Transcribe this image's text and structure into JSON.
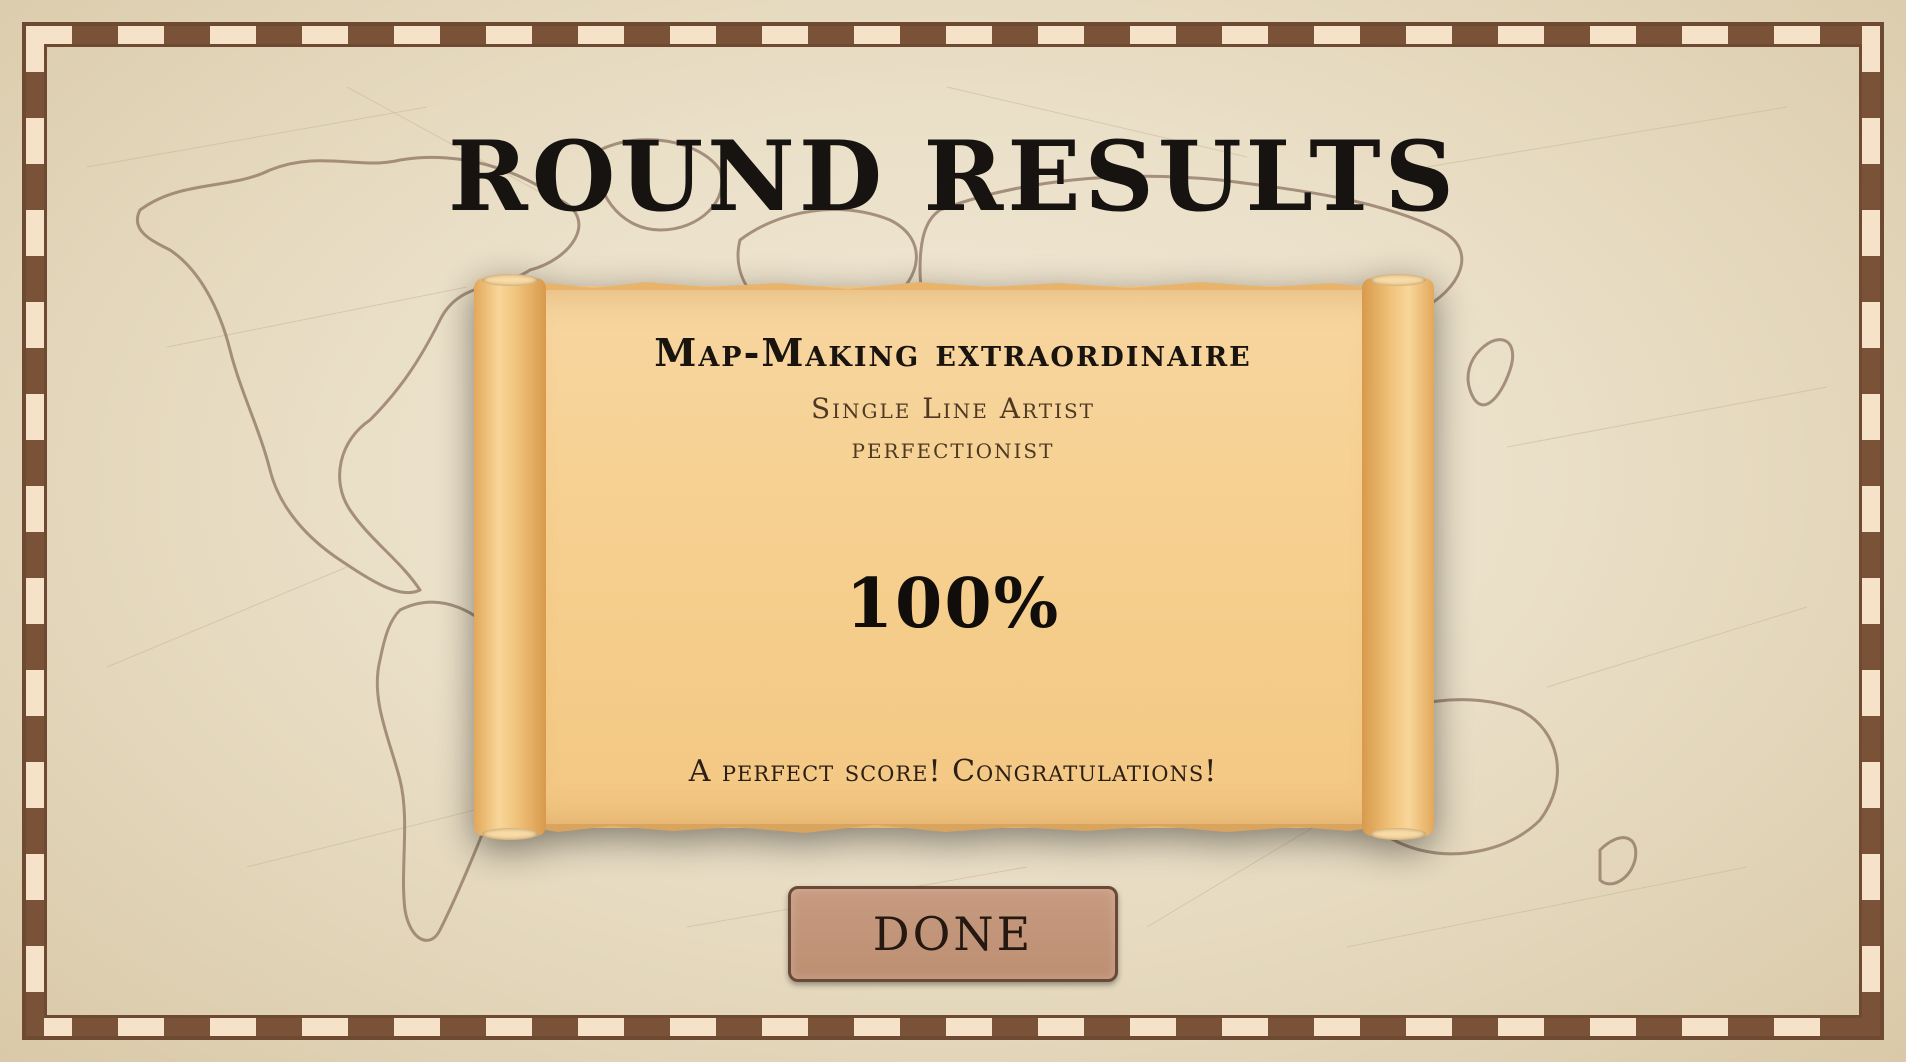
{
  "screen": {
    "title": "ROUND RESULTS"
  },
  "result": {
    "achievement_title": "Map-Making extraordinaire",
    "achievement_lines": [
      "Single Line Artist",
      "perfectionist"
    ],
    "score": "100%",
    "message": "A perfect score! Congratulations!"
  },
  "actions": {
    "done_label": "DONE"
  },
  "colors": {
    "parchment": "#eadfc7",
    "frame_brown": "#7a5238",
    "scroll_paper": "#f6cf8e",
    "button": "#c79b80",
    "map_lines": "#8a6e5a"
  }
}
